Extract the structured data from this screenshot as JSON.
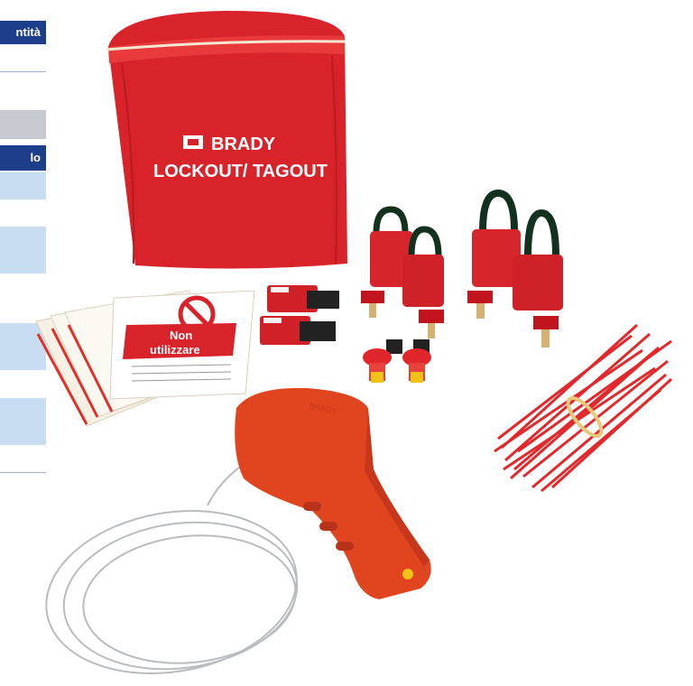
{
  "sidebar": {
    "header_quantity": "ntità",
    "header_article": "lo"
  },
  "product": {
    "brand": "BRADY",
    "bag_line": "LOCKOUT/ TAGOUT",
    "tag_line1": "Non",
    "tag_line2": "utilizzare",
    "tool_label": "BRADY"
  },
  "colors": {
    "header_blue": "#1d3f8b",
    "band_light": "#c8dcf2",
    "band_grey": "#c7cbd1",
    "product_red": "#e3282c"
  }
}
